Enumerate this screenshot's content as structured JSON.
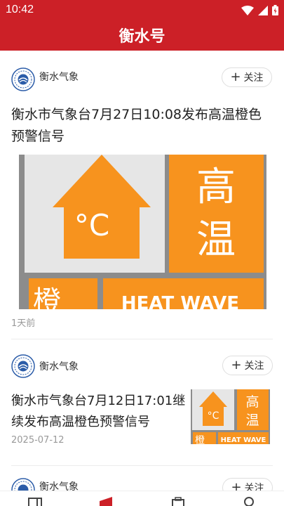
{
  "status_bar": {
    "time": "10:42",
    "icons": [
      "wifi-icon",
      "signal-icon",
      "battery-icon"
    ]
  },
  "app_bar": {
    "title": "衡水号"
  },
  "colors": {
    "brand_red": "#cc2027",
    "warning_orange": "#f7931e",
    "warning_gray": "#8c8c8c"
  },
  "feed": [
    {
      "author": "衡水气象",
      "follow_label": "关注",
      "title": "衡水市气象台7月27日10:08发布高温橙色预警信号",
      "time": "1天前",
      "image": {
        "chars_top": [
          "高",
          "温"
        ],
        "char_bottom_left": "橙",
        "celsius": "°C",
        "english": "HEAT WAVE"
      }
    },
    {
      "author": "衡水气象",
      "follow_label": "关注",
      "title": "衡水市气象台7月12日17:01继续发布高温橙色预警信号",
      "time": "2025-07-12",
      "image": {
        "chars_top": [
          "高",
          "温"
        ],
        "char_bottom_left": "橙",
        "celsius": "°C",
        "english": "HEAT WAVE"
      }
    },
    {
      "author": "衡水气象",
      "follow_label": "关注"
    }
  ],
  "bottom_nav": [
    "home-icon",
    "flag-icon",
    "clipboard-icon",
    "profile-icon"
  ]
}
